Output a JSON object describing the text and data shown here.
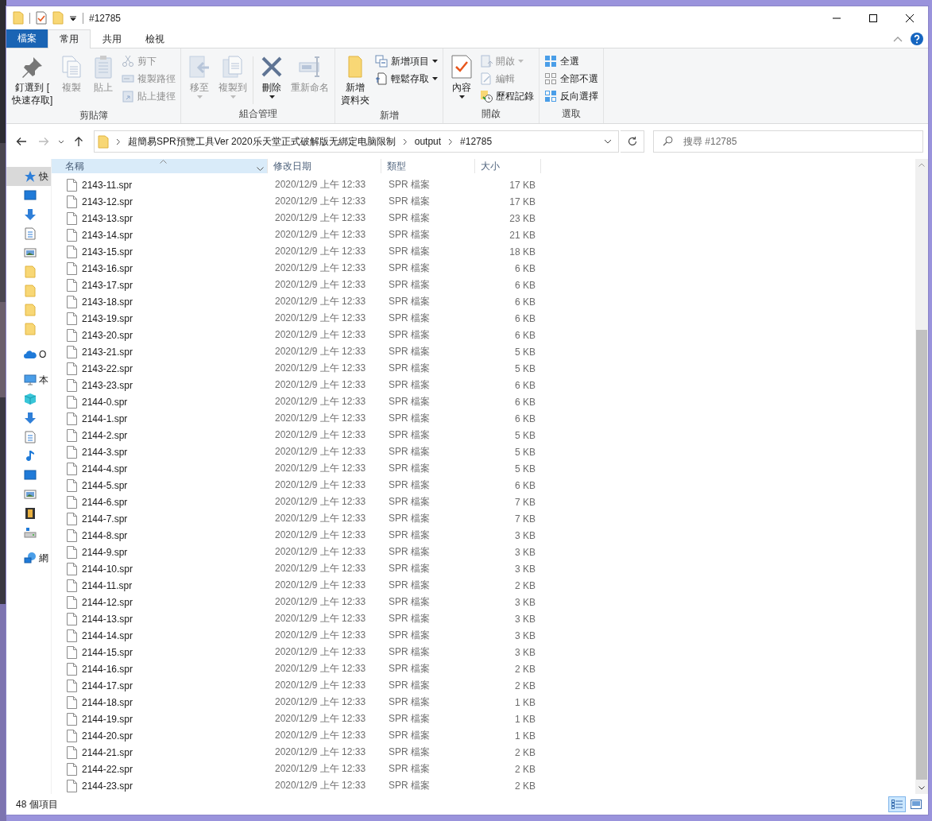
{
  "window": {
    "title": "#12785"
  },
  "tabs": [
    {
      "label": "檔案",
      "kind": "file",
      "selected": false
    },
    {
      "label": "常用",
      "kind": "tab",
      "selected": true
    },
    {
      "label": "共用",
      "kind": "tab",
      "selected": false
    },
    {
      "label": "檢視",
      "kind": "tab",
      "selected": false
    }
  ],
  "ribbon": {
    "groups": [
      {
        "label": "剪貼簿",
        "items": [
          {
            "kind": "large",
            "label_lines": [
              "釘選到 [",
              "快速存取]"
            ],
            "disabled": false,
            "dropdown": false
          },
          {
            "kind": "large",
            "label_lines": [
              "複製"
            ],
            "disabled": true,
            "dropdown": false
          },
          {
            "kind": "large",
            "label_lines": [
              "貼上"
            ],
            "disabled": true,
            "dropdown": false
          },
          {
            "kind": "stack",
            "items": [
              {
                "label": "剪下",
                "disabled": true,
                "dropdown": false
              },
              {
                "label": "複製路徑",
                "disabled": true,
                "dropdown": false
              },
              {
                "label": "貼上捷徑",
                "disabled": true,
                "dropdown": false
              }
            ]
          }
        ]
      },
      {
        "label": "組合管理",
        "items": [
          {
            "kind": "large",
            "label_lines": [
              "移至"
            ],
            "disabled": true,
            "dropdown": true
          },
          {
            "kind": "large",
            "label_lines": [
              "複製到"
            ],
            "disabled": true,
            "dropdown": true
          },
          {
            "kind": "separator"
          },
          {
            "kind": "large",
            "label_lines": [
              "刪除"
            ],
            "disabled": false,
            "dropdown": true
          },
          {
            "kind": "large",
            "label_lines": [
              "重新命名"
            ],
            "disabled": true,
            "dropdown": false
          }
        ]
      },
      {
        "label": "新增",
        "items": [
          {
            "kind": "large",
            "label_lines": [
              "新增",
              "資料夾"
            ],
            "disabled": false,
            "dropdown": false
          },
          {
            "kind": "stack",
            "items": [
              {
                "label": "新增項目",
                "disabled": false,
                "dropdown": true
              },
              {
                "label": "輕鬆存取",
                "disabled": false,
                "dropdown": true
              }
            ]
          }
        ]
      },
      {
        "label": "開啟",
        "items": [
          {
            "kind": "large",
            "label_lines": [
              "內容"
            ],
            "disabled": false,
            "dropdown": true
          },
          {
            "kind": "stack",
            "items": [
              {
                "label": "開啟",
                "disabled": true,
                "dropdown": true
              },
              {
                "label": "編輯",
                "disabled": true,
                "dropdown": false
              },
              {
                "label": "歷程記錄",
                "disabled": false,
                "dropdown": false
              }
            ]
          }
        ]
      },
      {
        "label": "選取",
        "items": [
          {
            "kind": "stack",
            "items": [
              {
                "label": "全選",
                "disabled": false,
                "dropdown": false
              },
              {
                "label": "全部不選",
                "disabled": false,
                "dropdown": false
              },
              {
                "label": "反向選擇",
                "disabled": false,
                "dropdown": false
              }
            ]
          }
        ]
      }
    ]
  },
  "address_bar": {
    "back_disabled": false,
    "forward_disabled": true,
    "path": [
      "超簡易SPR預覽工具Ver 2020乐天堂正式破解版无綁定电脑限制",
      "output",
      "#12785"
    ],
    "search_placeholder": "搜尋 #12785"
  },
  "navigation": {
    "items": [
      {
        "label": "快",
        "selected": true
      },
      {
        "selected": false
      },
      {
        "selected": false
      },
      {
        "selected": false
      },
      {
        "selected": false
      },
      {
        "selected": false
      },
      {
        "selected": false
      },
      {
        "selected": false
      },
      {
        "selected": false
      },
      {
        "label": "O",
        "selected": false
      },
      {
        "label": "本",
        "selected": false
      },
      {
        "selected": false
      },
      {
        "selected": false
      },
      {
        "selected": false
      },
      {
        "selected": false
      },
      {
        "selected": false
      },
      {
        "selected": false
      },
      {
        "selected": false
      },
      {
        "selected": false
      },
      {
        "label": "網",
        "selected": false
      }
    ]
  },
  "file_list": {
    "columns": [
      {
        "label": "名稱",
        "selected": true
      },
      {
        "label": "修改日期",
        "selected": false
      },
      {
        "label": "類型",
        "selected": false
      },
      {
        "label": "大小",
        "selected": false
      }
    ],
    "rows": [
      {
        "name": "2143-11.spr",
        "modified": "2020/12/9 上午 12:33",
        "type": "SPR 檔案",
        "size": "17 KB"
      },
      {
        "name": "2143-12.spr",
        "modified": "2020/12/9 上午 12:33",
        "type": "SPR 檔案",
        "size": "17 KB"
      },
      {
        "name": "2143-13.spr",
        "modified": "2020/12/9 上午 12:33",
        "type": "SPR 檔案",
        "size": "23 KB"
      },
      {
        "name": "2143-14.spr",
        "modified": "2020/12/9 上午 12:33",
        "type": "SPR 檔案",
        "size": "21 KB"
      },
      {
        "name": "2143-15.spr",
        "modified": "2020/12/9 上午 12:33",
        "type": "SPR 檔案",
        "size": "18 KB"
      },
      {
        "name": "2143-16.spr",
        "modified": "2020/12/9 上午 12:33",
        "type": "SPR 檔案",
        "size": "6 KB"
      },
      {
        "name": "2143-17.spr",
        "modified": "2020/12/9 上午 12:33",
        "type": "SPR 檔案",
        "size": "6 KB"
      },
      {
        "name": "2143-18.spr",
        "modified": "2020/12/9 上午 12:33",
        "type": "SPR 檔案",
        "size": "6 KB"
      },
      {
        "name": "2143-19.spr",
        "modified": "2020/12/9 上午 12:33",
        "type": "SPR 檔案",
        "size": "6 KB"
      },
      {
        "name": "2143-20.spr",
        "modified": "2020/12/9 上午 12:33",
        "type": "SPR 檔案",
        "size": "6 KB"
      },
      {
        "name": "2143-21.spr",
        "modified": "2020/12/9 上午 12:33",
        "type": "SPR 檔案",
        "size": "5 KB"
      },
      {
        "name": "2143-22.spr",
        "modified": "2020/12/9 上午 12:33",
        "type": "SPR 檔案",
        "size": "5 KB"
      },
      {
        "name": "2143-23.spr",
        "modified": "2020/12/9 上午 12:33",
        "type": "SPR 檔案",
        "size": "6 KB"
      },
      {
        "name": "2144-0.spr",
        "modified": "2020/12/9 上午 12:33",
        "type": "SPR 檔案",
        "size": "6 KB"
      },
      {
        "name": "2144-1.spr",
        "modified": "2020/12/9 上午 12:33",
        "type": "SPR 檔案",
        "size": "6 KB"
      },
      {
        "name": "2144-2.spr",
        "modified": "2020/12/9 上午 12:33",
        "type": "SPR 檔案",
        "size": "5 KB"
      },
      {
        "name": "2144-3.spr",
        "modified": "2020/12/9 上午 12:33",
        "type": "SPR 檔案",
        "size": "5 KB"
      },
      {
        "name": "2144-4.spr",
        "modified": "2020/12/9 上午 12:33",
        "type": "SPR 檔案",
        "size": "5 KB"
      },
      {
        "name": "2144-5.spr",
        "modified": "2020/12/9 上午 12:33",
        "type": "SPR 檔案",
        "size": "6 KB"
      },
      {
        "name": "2144-6.spr",
        "modified": "2020/12/9 上午 12:33",
        "type": "SPR 檔案",
        "size": "7 KB"
      },
      {
        "name": "2144-7.spr",
        "modified": "2020/12/9 上午 12:33",
        "type": "SPR 檔案",
        "size": "7 KB"
      },
      {
        "name": "2144-8.spr",
        "modified": "2020/12/9 上午 12:33",
        "type": "SPR 檔案",
        "size": "3 KB"
      },
      {
        "name": "2144-9.spr",
        "modified": "2020/12/9 上午 12:33",
        "type": "SPR 檔案",
        "size": "3 KB"
      },
      {
        "name": "2144-10.spr",
        "modified": "2020/12/9 上午 12:33",
        "type": "SPR 檔案",
        "size": "3 KB"
      },
      {
        "name": "2144-11.spr",
        "modified": "2020/12/9 上午 12:33",
        "type": "SPR 檔案",
        "size": "2 KB"
      },
      {
        "name": "2144-12.spr",
        "modified": "2020/12/9 上午 12:33",
        "type": "SPR 檔案",
        "size": "3 KB"
      },
      {
        "name": "2144-13.spr",
        "modified": "2020/12/9 上午 12:33",
        "type": "SPR 檔案",
        "size": "3 KB"
      },
      {
        "name": "2144-14.spr",
        "modified": "2020/12/9 上午 12:33",
        "type": "SPR 檔案",
        "size": "3 KB"
      },
      {
        "name": "2144-15.spr",
        "modified": "2020/12/9 上午 12:33",
        "type": "SPR 檔案",
        "size": "3 KB"
      },
      {
        "name": "2144-16.spr",
        "modified": "2020/12/9 上午 12:33",
        "type": "SPR 檔案",
        "size": "2 KB"
      },
      {
        "name": "2144-17.spr",
        "modified": "2020/12/9 上午 12:33",
        "type": "SPR 檔案",
        "size": "2 KB"
      },
      {
        "name": "2144-18.spr",
        "modified": "2020/12/9 上午 12:33",
        "type": "SPR 檔案",
        "size": "1 KB"
      },
      {
        "name": "2144-19.spr",
        "modified": "2020/12/9 上午 12:33",
        "type": "SPR 檔案",
        "size": "1 KB"
      },
      {
        "name": "2144-20.spr",
        "modified": "2020/12/9 上午 12:33",
        "type": "SPR 檔案",
        "size": "1 KB"
      },
      {
        "name": "2144-21.spr",
        "modified": "2020/12/9 上午 12:33",
        "type": "SPR 檔案",
        "size": "2 KB"
      },
      {
        "name": "2144-22.spr",
        "modified": "2020/12/9 上午 12:33",
        "type": "SPR 檔案",
        "size": "2 KB"
      },
      {
        "name": "2144-23.spr",
        "modified": "2020/12/9 上午 12:33",
        "type": "SPR 檔案",
        "size": "2 KB"
      }
    ]
  },
  "status_bar": {
    "item_count": "48 個項目",
    "views": [
      {
        "selected": true
      },
      {
        "selected": false
      }
    ]
  }
}
